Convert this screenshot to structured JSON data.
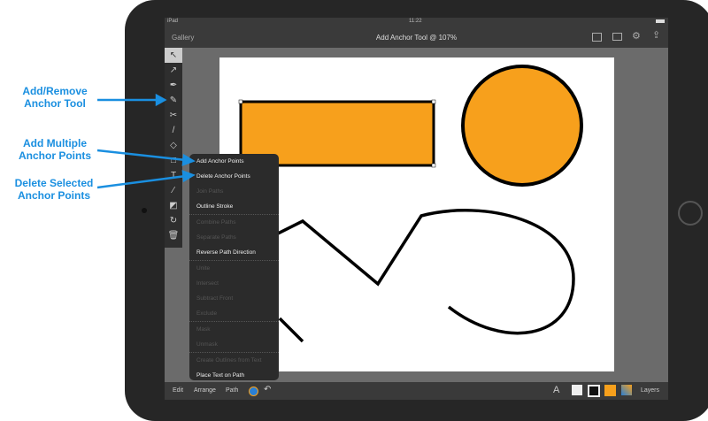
{
  "status": {
    "device": "iPad",
    "time": "11:22"
  },
  "nav": {
    "back": "Gallery",
    "title": "Add Anchor Tool @ 107%",
    "icons": [
      "fit-screen-icon",
      "image-icon",
      "gear-icon",
      "share-icon"
    ]
  },
  "menu": [
    {
      "label": "Add Anchor Points",
      "enabled": true
    },
    {
      "label": "Delete Anchor Points",
      "enabled": true
    },
    {
      "label": "Join Paths",
      "enabled": false
    },
    {
      "label": "Outline Stroke",
      "enabled": true
    },
    {
      "label": "Combine Paths",
      "enabled": false
    },
    {
      "label": "Separate Paths",
      "enabled": false
    },
    {
      "label": "Reverse Path Direction",
      "enabled": true
    },
    {
      "label": "Unite",
      "enabled": false
    },
    {
      "label": "Intersect",
      "enabled": false
    },
    {
      "label": "Subtract Front",
      "enabled": false
    },
    {
      "label": "Exclude",
      "enabled": false
    },
    {
      "label": "Mask",
      "enabled": false
    },
    {
      "label": "Unmask",
      "enabled": false
    },
    {
      "label": "Create Outlines from Text",
      "enabled": false
    },
    {
      "label": "Place Text on Path",
      "enabled": true
    }
  ],
  "bottom": {
    "edit": "Edit",
    "arrange": "Arrange",
    "path": "Path",
    "layers": "Layers"
  },
  "annotations": {
    "a1": "Add/Remove Anchor Tool",
    "a2": "Add Multiple Anchor Points",
    "a3": "Delete Selected Anchor Points"
  },
  "colors": {
    "accent": "#1a8fe0",
    "fill": "#f7a01c"
  }
}
